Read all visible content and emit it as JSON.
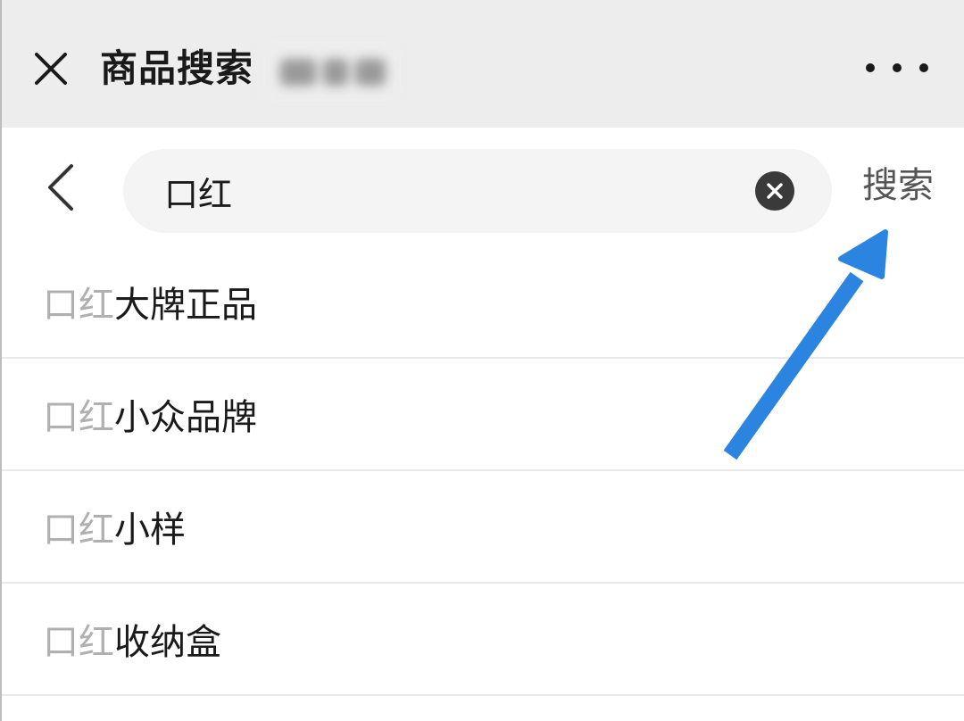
{
  "header": {
    "title": "商品搜索",
    "close_icon": "close-icon",
    "more_icon": "more-icon"
  },
  "search": {
    "query": "口红",
    "button_label": "搜索",
    "back_icon": "chevron-left-icon",
    "clear_icon": "clear-circle-icon"
  },
  "suggestions": [
    {
      "match": "口红",
      "rest": "大牌正品"
    },
    {
      "match": "口红",
      "rest": "小众品牌"
    },
    {
      "match": "口红",
      "rest": "小样"
    },
    {
      "match": "口红",
      "rest": "收纳盒"
    }
  ],
  "colors": {
    "titlebar_bg": "#ededed",
    "search_box_bg": "#f4f4f4",
    "match_text": "#b0b0b0",
    "annotation_arrow": "#2a84e0"
  }
}
